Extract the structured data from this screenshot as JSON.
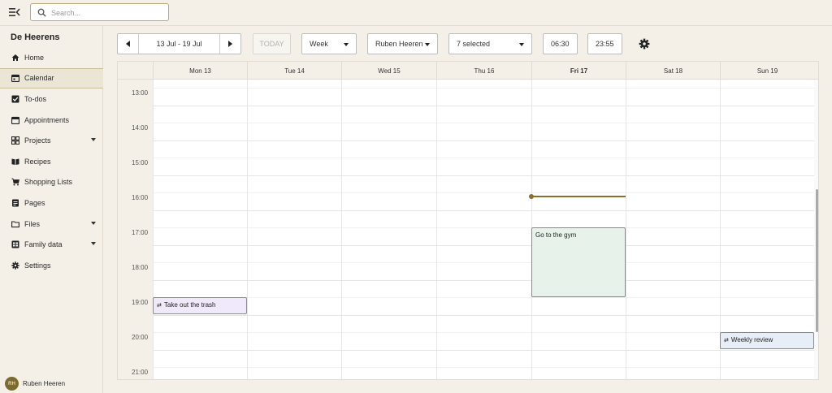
{
  "topbar": {
    "search_placeholder": "Search..."
  },
  "sidebar": {
    "org_name": "De Heerens",
    "items": [
      {
        "label": "Home",
        "icon": "home-icon"
      },
      {
        "label": "Calendar",
        "icon": "calendar-icon",
        "active": true
      },
      {
        "label": "To-dos",
        "icon": "checkbox-icon"
      },
      {
        "label": "Appointments",
        "icon": "calendar-icon"
      },
      {
        "label": "Projects",
        "icon": "grid-icon",
        "expandable": true
      },
      {
        "label": "Recipes",
        "icon": "book-icon"
      },
      {
        "label": "Shopping Lists",
        "icon": "cart-icon"
      },
      {
        "label": "Pages",
        "icon": "page-icon"
      },
      {
        "label": "Files",
        "icon": "folder-icon",
        "expandable": true
      },
      {
        "label": "Family data",
        "icon": "table-icon",
        "expandable": true
      },
      {
        "label": "Settings",
        "icon": "gear-icon"
      }
    ],
    "user": {
      "initials": "RH",
      "name": "Ruben Heeren"
    }
  },
  "toolbar": {
    "date_range": "13 Jul - 19 Jul",
    "today_label": "TODAY",
    "view": "Week",
    "person": "Ruben Heeren",
    "selected": "7 selected",
    "start_time": "06:30",
    "end_time": "23:55"
  },
  "calendar": {
    "days": [
      "Mon 13",
      "Tue 14",
      "Wed 15",
      "Thu 16",
      "Fri 17",
      "Sat 18",
      "Sun 19"
    ],
    "current_day_index": 4,
    "hours": [
      "13:00",
      "14:00",
      "15:00",
      "16:00",
      "17:00",
      "18:00",
      "19:00",
      "20:00",
      "21:00"
    ],
    "events": [
      {
        "title": "Take out the trash",
        "day": 0,
        "start": "19:00",
        "end": "19:30",
        "recurring": true,
        "color": "#efe9fb"
      },
      {
        "title": "Go to the gym",
        "day": 4,
        "start": "17:00",
        "end": "19:00",
        "recurring": false,
        "color": "#e7f3ea"
      },
      {
        "title": "Weekly review",
        "day": 6,
        "start": "20:00",
        "end": "20:30",
        "recurring": true,
        "color": "#e7eef8"
      }
    ],
    "current_time": "15:30"
  },
  "colors": {
    "accent": "#8a6f2a",
    "background": "#f4f0e8"
  }
}
